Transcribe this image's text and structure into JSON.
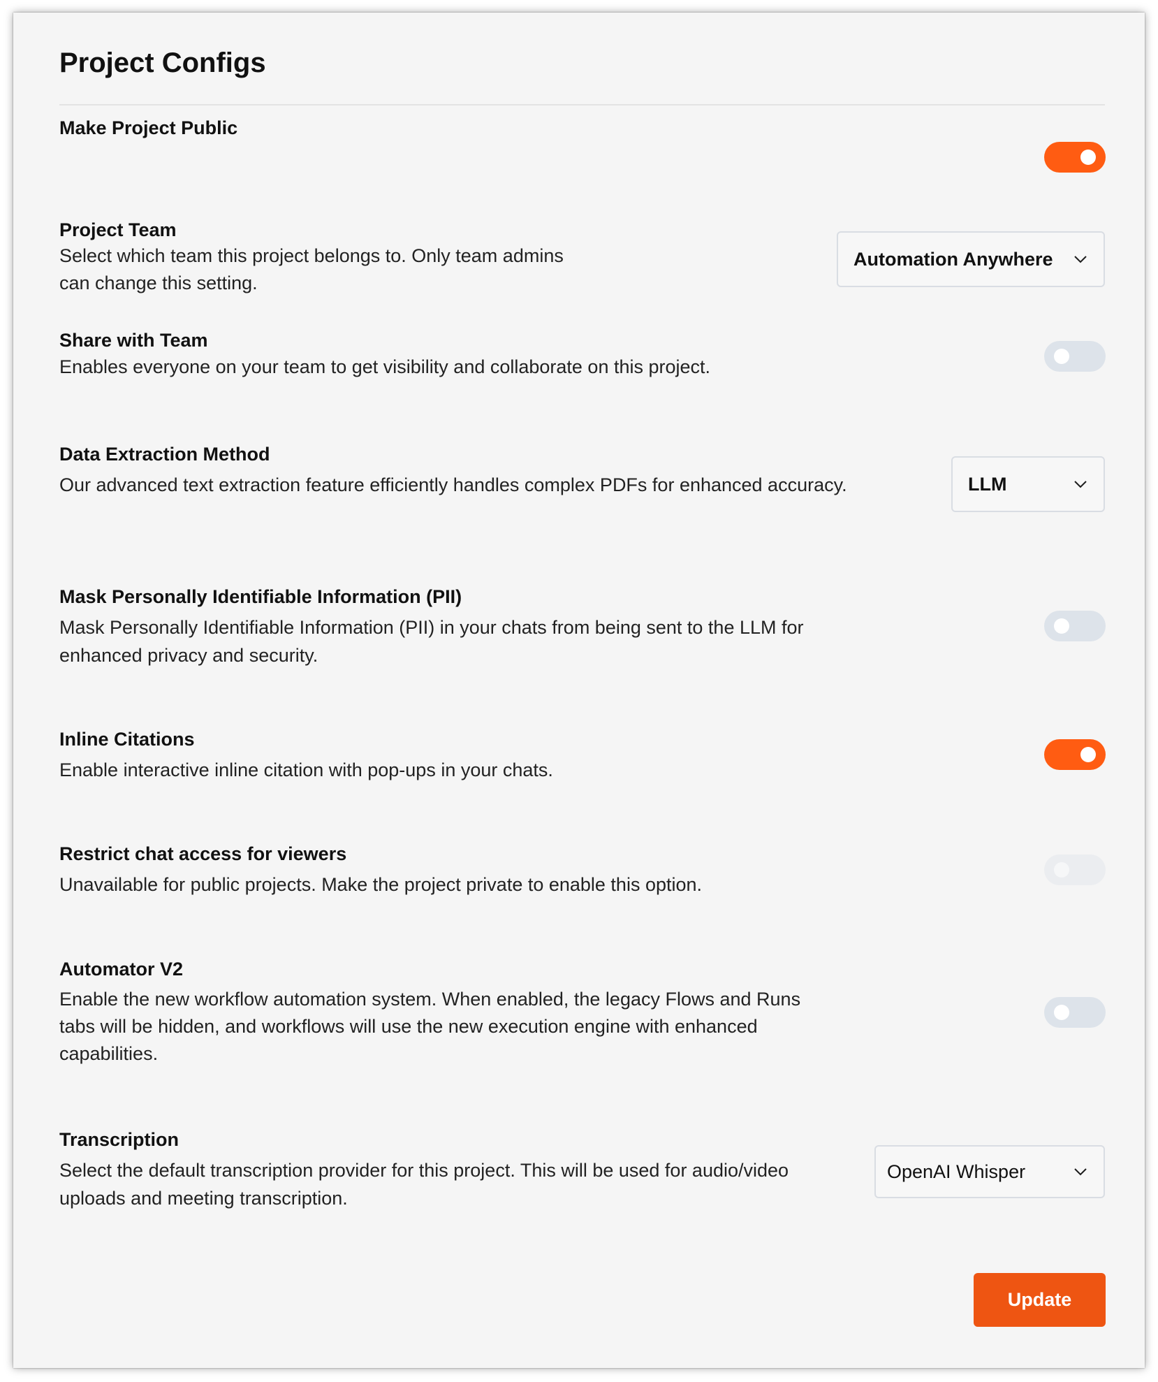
{
  "page": {
    "title": "Project Configs"
  },
  "settings": {
    "make_public": {
      "title": "Make Project Public",
      "enabled": true
    },
    "project_team": {
      "title": "Project Team",
      "description": "Select which team this project belongs to. Only team admins can change this setting.",
      "selected": "Automation Anywhere"
    },
    "share_with_team": {
      "title": "Share with Team",
      "description": "Enables everyone on your team to get visibility and collaborate on this project.",
      "enabled": false
    },
    "data_extraction": {
      "title": "Data Extraction Method",
      "description": "Our advanced text extraction feature efficiently handles complex PDFs for enhanced accuracy.",
      "selected": "LLM"
    },
    "mask_pii": {
      "title": "Mask Personally Identifiable Information (PII)",
      "description": "Mask Personally Identifiable Information (PII) in your chats from being sent to the LLM for enhanced privacy and security.",
      "enabled": false
    },
    "inline_citations": {
      "title": "Inline Citations",
      "description": "Enable interactive inline citation with pop-ups in your chats.",
      "enabled": true
    },
    "restrict_chat": {
      "title": "Restrict chat access for viewers",
      "description": "Unavailable for public projects. Make the project private to enable this option.",
      "enabled": false,
      "disabled": true
    },
    "automator_v2": {
      "title": "Automator V2",
      "description": "Enable the new workflow automation system. When enabled, the legacy Flows and Runs tabs will be hidden, and workflows will use the new execution engine with enhanced capabilities.",
      "enabled": false
    },
    "transcription": {
      "title": "Transcription",
      "description": "Select the default transcription provider for this project. This will be used for audio/video uploads and meeting transcription.",
      "selected": "OpenAI Whisper"
    }
  },
  "actions": {
    "update_label": "Update"
  },
  "colors": {
    "accent": "#ff5c12",
    "toggle_off": "#dde3ea",
    "background": "#f5f5f5"
  },
  "icons": {
    "dropdown": "chevron-down-icon"
  }
}
